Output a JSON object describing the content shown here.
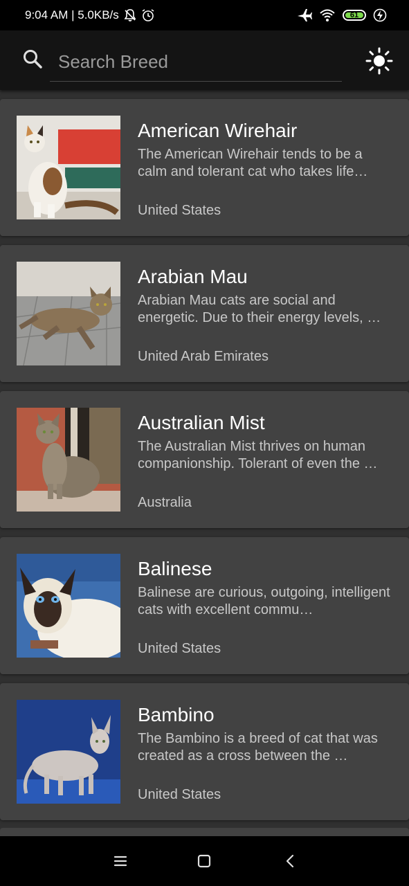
{
  "status_bar": {
    "time_speed": "9:04 AM | 5.0KB/s",
    "battery": "61",
    "icons": [
      "mute-bell-icon",
      "alarm-icon",
      "airplane-icon",
      "wifi-icon",
      "battery-icon",
      "charging-icon"
    ]
  },
  "search": {
    "placeholder": "Search Breed",
    "value": "",
    "icon": "search-icon",
    "theme_icon": "sun-icon"
  },
  "breeds": [
    {
      "name": "American Wirehair",
      "description": "The American Wirehair tends to be a calm and tolerant cat who takes life…",
      "origin": "United States"
    },
    {
      "name": "Arabian Mau",
      "description": "Arabian Mau cats are social and energetic. Due to their energy levels, …",
      "origin": "United Arab Emirates"
    },
    {
      "name": "Australian Mist",
      "description": "The Australian Mist thrives on human companionship. Tolerant of even the …",
      "origin": "Australia"
    },
    {
      "name": "Balinese",
      "description": "Balinese are curious, outgoing, intelligent cats with excellent commu…",
      "origin": "United States"
    },
    {
      "name": "Bambino",
      "description": "The Bambino is a breed of cat that was created as a cross between the …",
      "origin": "United States"
    }
  ],
  "nav_bar": {
    "icons": [
      "menu-icon",
      "home-square-icon",
      "back-chevron-icon"
    ]
  },
  "colors": {
    "background": "#303030",
    "card": "#424242",
    "app_bar": "#141414",
    "battery_fill": "#7cd94a"
  }
}
